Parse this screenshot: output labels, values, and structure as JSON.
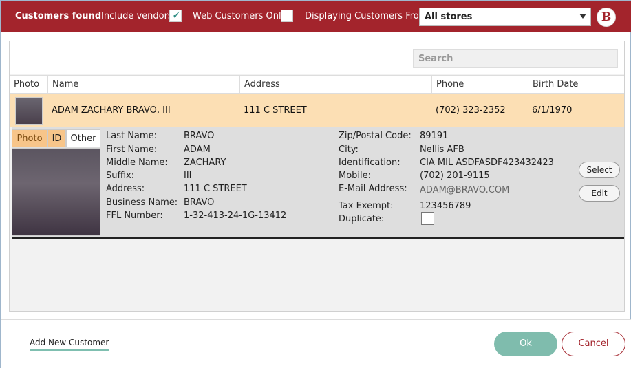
{
  "topbar": {
    "title": "Customers found",
    "include_vendors_label": "Include vendors",
    "include_vendors_checked": true,
    "web_only_label": "Web Customers Only",
    "web_only_checked": false,
    "displaying_from_label": "Displaying Customers From:",
    "store_selected": "All stores",
    "logo_letter": "B",
    "accent_color": "#a3242c"
  },
  "search": {
    "placeholder": "Search",
    "value": ""
  },
  "table": {
    "columns": [
      "Photo",
      "Name",
      "Address",
      "Phone",
      "Birth Date"
    ],
    "rows": [
      {
        "name": "ADAM ZACHARY BRAVO, III",
        "address": "111 C STREET",
        "phone": "(702) 323-2352",
        "birth_date": "6/1/1970"
      }
    ],
    "selected_row_color": "#fcdfb4"
  },
  "detail": {
    "tabs": [
      "Photo",
      "ID",
      "Other"
    ],
    "left_fields": [
      {
        "label": "Last Name:",
        "value": "BRAVO"
      },
      {
        "label": "First Name:",
        "value": "ADAM"
      },
      {
        "label": "Middle Name:",
        "value": "ZACHARY"
      },
      {
        "label": "Suffix:",
        "value": "III"
      },
      {
        "label": "Address:",
        "value": "111 C STREET"
      },
      {
        "label": "Business Name:",
        "value": "BRAVO"
      },
      {
        "label": "FFL Number:",
        "value": "1-32-413-24-1G-13412"
      }
    ],
    "right_fields": [
      {
        "label": "Zip/Postal Code:",
        "value": "89191"
      },
      {
        "label": "City:",
        "value": "Nellis AFB"
      },
      {
        "label": "Identification:",
        "value": "CIA MIL ASDFASDF423432423"
      },
      {
        "label": "Mobile:",
        "value": "(702) 201-9115"
      },
      {
        "label": "E-Mail Address:",
        "value": "ADAM@BRAVO.COM"
      },
      {
        "label": "Tax Exempt:",
        "value": "123456789"
      },
      {
        "label": "Duplicate:",
        "value": ""
      }
    ],
    "select_label": "Select",
    "edit_label": "Edit"
  },
  "footer": {
    "add_new_label": "Add New Customer",
    "ok_label": "Ok",
    "cancel_label": "Cancel",
    "ok_color": "#7fbcad"
  }
}
